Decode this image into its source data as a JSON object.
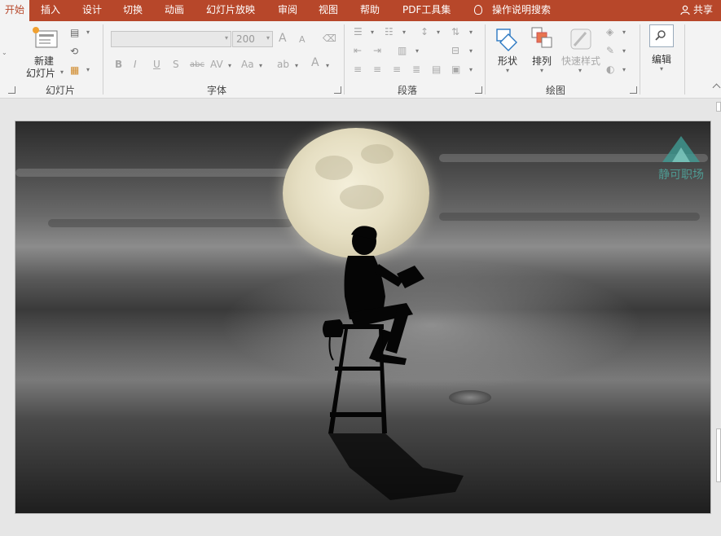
{
  "tabs": [
    {
      "label": "开始",
      "active": true
    },
    {
      "label": "插入"
    },
    {
      "label": "设计"
    },
    {
      "label": "切换"
    },
    {
      "label": "动画"
    },
    {
      "label": "幻灯片放映"
    },
    {
      "label": "审阅"
    },
    {
      "label": "视图"
    },
    {
      "label": "帮助"
    },
    {
      "label": "PDF工具集"
    },
    {
      "label": "操作说明搜索",
      "icon": "lightbulb-icon"
    }
  ],
  "share_label": "共享",
  "ribbon": {
    "slides": {
      "new_slide_label_1": "新建",
      "new_slide_label_2": "幻灯片",
      "group_label": "幻灯片"
    },
    "font": {
      "font_name": "",
      "font_size": "200",
      "group_label": "字体",
      "bold": "B",
      "italic": "I",
      "underline": "U",
      "shadow": "S",
      "strike": "abc",
      "spacing": "AV",
      "case": "Aa",
      "color": "A",
      "grow": "A",
      "shrink": "A"
    },
    "paragraph": {
      "group_label": "段落"
    },
    "drawing": {
      "shapes_label": "形状",
      "arrange_label": "排列",
      "quick_styles_label": "快速样式",
      "group_label": "绘图"
    },
    "editing": {
      "label": "编辑"
    }
  },
  "slide": {
    "watermark_text": "静可职场"
  },
  "colors": {
    "accent": "#b7472a",
    "ribbon_bg": "#f3f3f3",
    "workspace_bg": "#e6e6e6",
    "logo": "#4fa9a0"
  }
}
